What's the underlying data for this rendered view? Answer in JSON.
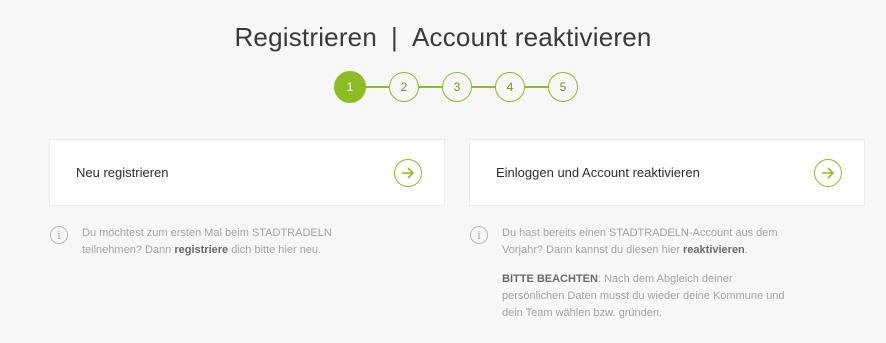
{
  "header": {
    "title_left": "Registrieren",
    "separator": "|",
    "title_right": "Account reaktivieren"
  },
  "steps": {
    "items": [
      "1",
      "2",
      "3",
      "4",
      "5"
    ],
    "active_index": 0,
    "accent_color": "#8cbd24"
  },
  "cards": {
    "register": {
      "label": "Neu registrieren",
      "icon": "arrow-right-circle-icon"
    },
    "reactivate": {
      "label": "Einloggen und Account reaktivieren",
      "icon": "arrow-right-circle-icon"
    }
  },
  "info": {
    "register": {
      "icon": "info-icon",
      "text_before": "Du möchtest zum ersten Mal beim STADTRADELN teilnehmen? Dann ",
      "bold": "registriere",
      "text_after": " dich bitte hier neu."
    },
    "reactivate": {
      "icon": "info-icon",
      "text_before": "Du hast bereits einen STADTRADELN-Account aus dem Vorjahr? Dann kannst du diesen hier ",
      "bold": "reaktivieren",
      "text_after": ".",
      "note_bold": "BITTE BEACHTEN",
      "note_text": ": Nach dem Abgleich deiner persönlichen Daten musst du wieder deine Kommune und dein Team wählen bzw. gründen."
    }
  }
}
